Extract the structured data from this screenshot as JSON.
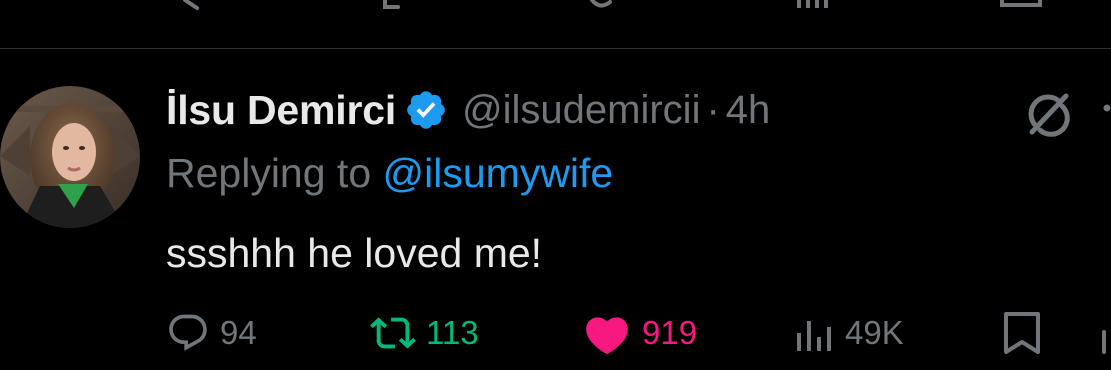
{
  "tweet": {
    "display_name": "İlsu Demirci",
    "handle": "@ilsudemircii",
    "separator": "·",
    "time": "4h",
    "reply_prefix": "Replying to",
    "reply_mention": "@ilsumywife",
    "text": "ssshhh he loved me!"
  },
  "actions": {
    "replies": "94",
    "reposts": "113",
    "likes": "919",
    "views": "49K"
  },
  "colors": {
    "background": "#000000",
    "primary_text": "#e7e9ea",
    "secondary_text": "#71767b",
    "verified_blue": "#1d9bf0",
    "link_blue": "#1d9bf0",
    "repost_green": "#00ba7c",
    "like_pink": "#f91880",
    "divider": "#2f3336"
  },
  "icons": {
    "verified": "verified-badge-icon",
    "grok": "grok-icon",
    "more": "more-dots-icon",
    "reply": "reply-bubble-icon",
    "repost": "repost-arrows-icon",
    "like": "heart-filled-icon",
    "views": "views-bars-icon",
    "bookmark": "bookmark-icon",
    "share": "share-icon"
  }
}
